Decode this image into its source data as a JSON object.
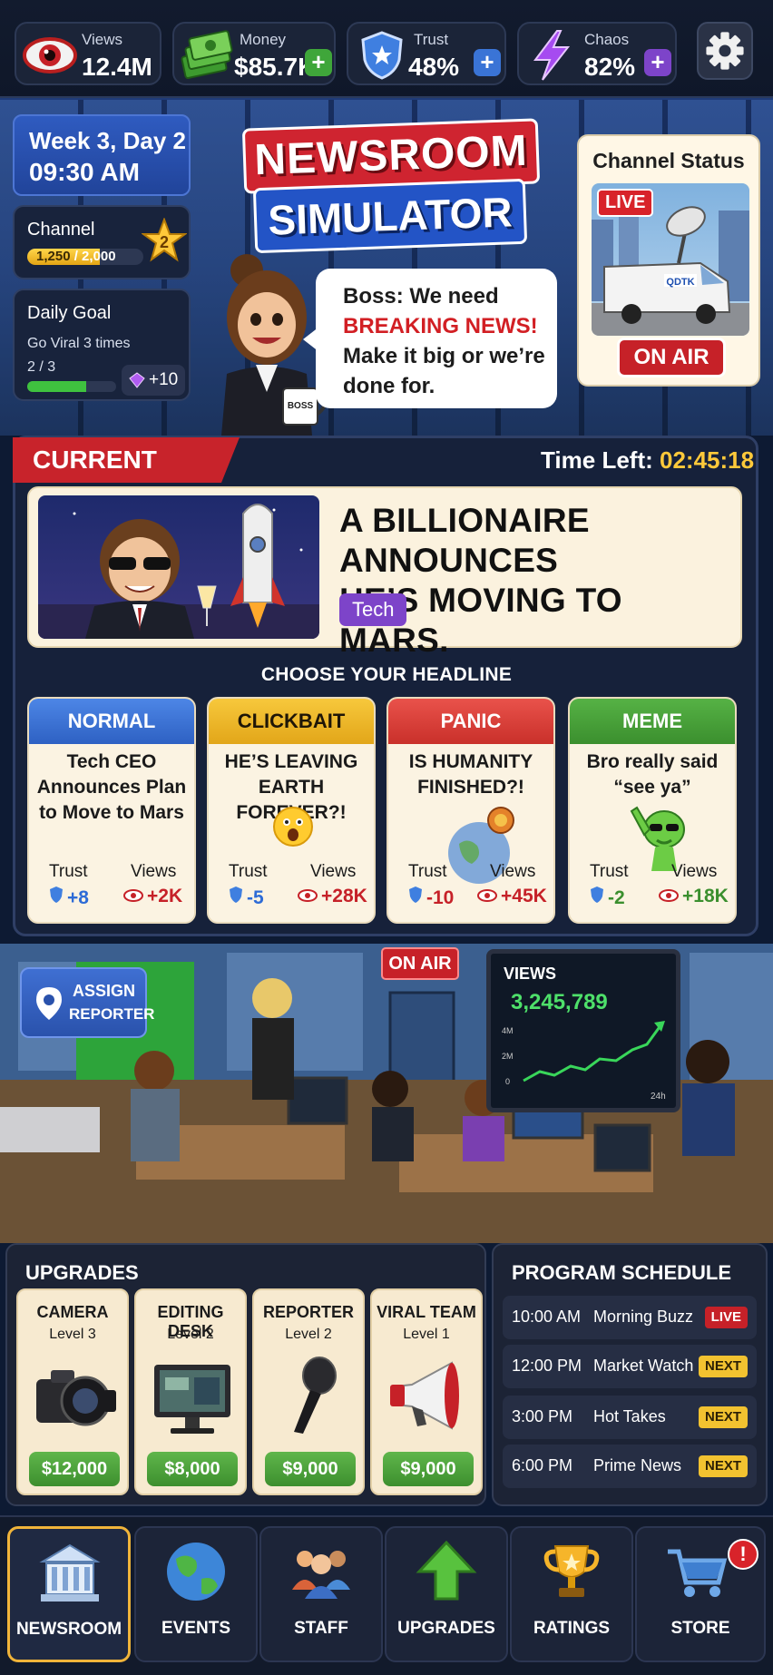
{
  "stats": [
    {
      "label": "Views",
      "value": "12.4M",
      "icon": "eye-icon"
    },
    {
      "label": "Money",
      "value": "$85.7K",
      "icon": "cash-icon"
    },
    {
      "label": "Trust",
      "value": "48%",
      "icon": "shield-icon"
    },
    {
      "label": "Chaos",
      "value": "82%",
      "icon": "lightning-icon"
    }
  ],
  "colors": {
    "accent_red": "#cf2430",
    "accent_blue": "#2354c6",
    "gold": "#ffc93a",
    "green": "#3fc23f",
    "purple": "#7d44c9"
  },
  "hud": {
    "week": "Week 3, Day 2",
    "time": "09:30 AM",
    "channel_label": "Channel",
    "channel_level": "2",
    "channel_progress": "1,250 / 2,000",
    "channel_progress_current": "1,250",
    "channel_progress_max": "/ 2,000",
    "channel_fraction": 0.625,
    "daily_goal_label": "Daily Goal",
    "daily_goal_task": "Go Viral 3 times",
    "daily_goal_progress": "2 / 3",
    "daily_goal_fraction": 0.667,
    "daily_goal_reward": "+10"
  },
  "title": {
    "line1": "NEWSROOM",
    "line2": "SIMULATOR"
  },
  "boss": {
    "speech_prefix": "Boss: We need",
    "speech_highlight": "BREAKING NEWS!",
    "speech_line3": "Make it big or we’re",
    "speech_line4": "done for.",
    "mug_text": "BOSS"
  },
  "channel_status": {
    "title": "Channel Status",
    "live_tag": "LIVE",
    "on_air": "ON AIR",
    "van_text": "QDTK"
  },
  "current_event": {
    "ribbon": "CURRENT EVENT",
    "time_left_label": "Time Left:",
    "time_left": "02:45:18",
    "headline_line1": "A BILLIONAIRE ANNOUNCES",
    "headline_line2": "HE’S MOVING TO MARS.",
    "tag": "Tech"
  },
  "choose_label": "CHOOSE YOUR HEADLINE",
  "headlines": [
    {
      "type": "NORMAL",
      "l1": "Tech CEO",
      "l2": "Announces Plan",
      "l3": "to Move to Mars",
      "trust_label": "Trust",
      "views_label": "Views",
      "trust": "+8",
      "views": "+2K"
    },
    {
      "type": "CLICKBAIT",
      "l1": "HE’S LEAVING",
      "l2": "EARTH FOREVER?!",
      "l3": "",
      "trust_label": "Trust",
      "views_label": "Views",
      "trust": "-5",
      "views": "+28K"
    },
    {
      "type": "PANIC",
      "l1": "IS HUMANITY",
      "l2": "FINISHED?!",
      "l3": "",
      "trust_label": "Trust",
      "views_label": "Views",
      "trust": "-10",
      "views": "+45K"
    },
    {
      "type": "MEME",
      "l1": "Bro really said",
      "l2": "“see ya”",
      "l3": "",
      "trust_label": "Trust",
      "views_label": "Views",
      "trust": "-2",
      "views": "+18K"
    }
  ],
  "office": {
    "assign_l1": "ASSIGN",
    "assign_l2": "REPORTER",
    "on_air_sign": "ON AIR",
    "views_board_title": "VIEWS",
    "views_board_count": "3,245,789",
    "views_axis": [
      "4M",
      "2M",
      "0"
    ],
    "views_axis_x": "24h"
  },
  "upgrades": {
    "title": "UPGRADES",
    "items": [
      {
        "name": "CAMERA",
        "level": "Level 3",
        "price": "$12,000",
        "icon": "camera-icon"
      },
      {
        "name": "EDITING DESK",
        "level": "Level 2",
        "price": "$8,000",
        "icon": "monitor-icon"
      },
      {
        "name": "REPORTER",
        "level": "Level 2",
        "price": "$9,000",
        "icon": "microphone-icon"
      },
      {
        "name": "VIRAL TEAM",
        "level": "Level 1",
        "price": "$9,000",
        "icon": "megaphone-icon"
      }
    ]
  },
  "schedule": {
    "title": "PROGRAM SCHEDULE",
    "rows": [
      {
        "time": "10:00 AM",
        "name": "Morning Buzz",
        "badge": "LIVE"
      },
      {
        "time": "12:00 PM",
        "name": "Market Watch",
        "badge": "NEXT"
      },
      {
        "time": "3:00 PM",
        "name": "Hot Takes",
        "badge": "NEXT"
      },
      {
        "time": "6:00 PM",
        "name": "Prime News",
        "badge": "NEXT"
      }
    ]
  },
  "nav": [
    {
      "label": "NEWSROOM",
      "icon": "building-icon",
      "active": true
    },
    {
      "label": "EVENTS",
      "icon": "globe-icon",
      "active": false
    },
    {
      "label": "STAFF",
      "icon": "people-icon",
      "active": false
    },
    {
      "label": "UPGRADES",
      "icon": "arrow-up-icon",
      "active": false
    },
    {
      "label": "RATINGS",
      "icon": "trophy-icon",
      "active": false
    },
    {
      "label": "STORE",
      "icon": "cart-icon",
      "active": false,
      "alert": "!"
    }
  ]
}
